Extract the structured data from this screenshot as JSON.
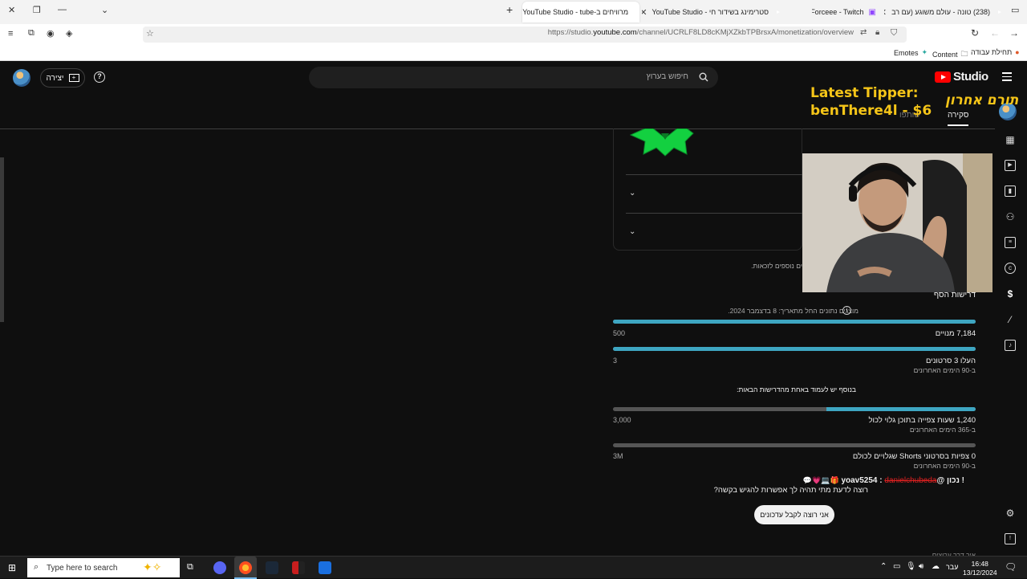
{
  "browser": {
    "tabs": [
      {
        "title": "מרוויחים ב-YouTube Studio - tube",
        "active": true
      },
      {
        "title": "סטרימינג בשידור חי - YouTube Studio",
        "active": false
      },
      {
        "title": "Forceee - Twitch",
        "active": false
      },
      {
        "title": "(238) טונה - עולם משוגע (עם רב",
        "active": false
      }
    ],
    "new_tab_symbol": "+",
    "url_prefix": "https://studio.",
    "url_domain": "youtube.com",
    "url_rest": "/channel/UCRLF8LD8cKMjXZkbTPBrsxA/monetization/overview"
  },
  "bookmarks": [
    {
      "label": "תחילת עבודה"
    },
    {
      "label": "Content"
    },
    {
      "label": "Emotes"
    }
  ],
  "header": {
    "logo_text": "Studio",
    "search_placeholder": "חיפוש בערוץ",
    "create_label": "יצירה",
    "help_symbol": "?"
  },
  "page_tabs": [
    {
      "label": "סקירה",
      "active": true
    },
    {
      "label": "שותפו",
      "active": false
    }
  ],
  "overlay": {
    "tipper_line1": "Latest Tipper:",
    "tipper_line2": "benThere4l - $6",
    "header_he": "תורם אחרון"
  },
  "content": {
    "truncated_note": "ים נוספים לזכאות.",
    "section_title": "דרישות הסף",
    "updated_note": "מוצגים נתונים החל מתאריך: 8 בדצמבר 2024.",
    "requirements": [
      {
        "label": "7,184 מנויים",
        "sub": "",
        "target": "500",
        "progress": 1.0
      },
      {
        "label": "העלו 3 סרטונים",
        "sub": "ב-90 הימים האחרונים",
        "target": "3",
        "progress": 1.0
      }
    ],
    "either_note": "בנוסף יש לעמוד באחת מהדרישות הבאות:",
    "either_requirements": [
      {
        "label": "1,240 שעות צפייה בתוכן גלוי לכול",
        "sub": "ב-365 הימים האחרונים",
        "target": "3,000",
        "progress": 0.413
      },
      {
        "label": "0 צפיות בסרטוני Shorts שגלויים לכולם",
        "sub": "ב-90 הימים האחרונים",
        "target": "3M",
        "progress": 0.0
      }
    ],
    "footer_partial": "איך דרך ערוצים"
  },
  "chat": {
    "badge_text": "! נכון",
    "user": "@yoav5254",
    "sep": ":",
    "mention": "danielchubeda",
    "message": "רוצה לדעת מתי תהיה לך אפשרות להגיש בקשה?",
    "button_label": "אני רוצה לקבל עדכונים"
  },
  "taskbar": {
    "search_placeholder": "Type here to search",
    "language": "עבר",
    "time": "16:48",
    "date": "13/12/2024"
  },
  "colors": {
    "progress_fill": "#3ea6c2",
    "progress_track": "#555555",
    "tipper_text": "#f5c518",
    "brand_red": "#ff0000"
  }
}
